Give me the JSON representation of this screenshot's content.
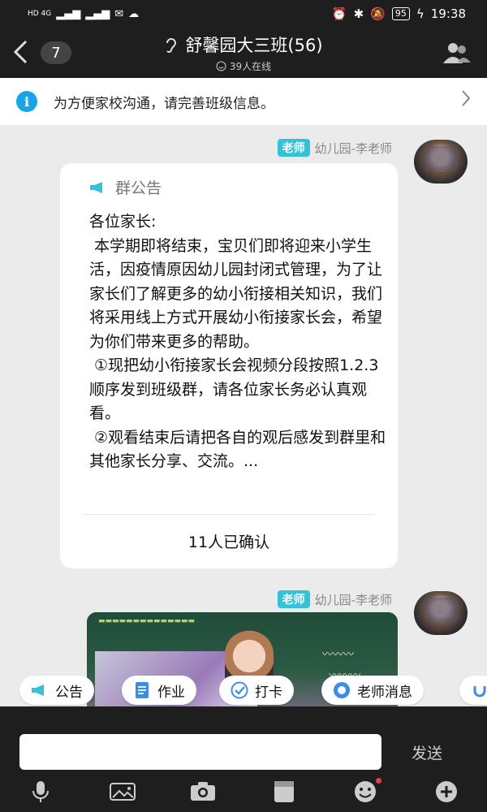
{
  "status_bar": {
    "network": "HD 4G",
    "time": "19:38",
    "battery": "95"
  },
  "header": {
    "unread_count": "7",
    "title": "舒馨园大三班(56)",
    "online": "39人在线"
  },
  "notice_banner": {
    "text": "为方便家校沟通，请完善班级信息。"
  },
  "messages": [
    {
      "role_tag": "老师",
      "sender": "幼儿园-李老师",
      "card_title": "群公告",
      "body": "各位家长:\n 本学期即将结束，宝贝们即将迎来小学生活，因疫情原因幼儿园封闭式管理，为了让家长们了解更多的幼小衔接相关知识，我们将采用线上方式开展幼小衔接家长会，希望为你们带来更多的帮助。\n ①现把幼小衔接家长会视频分段按照1.2.3顺序发到班级群，请各位家长务必认真观看。\n ②观看结束后请把各自的观后感发到群里和其他家长分享、交流。...",
      "confirm_text": "11人已确认"
    },
    {
      "role_tag": "老师",
      "sender": "幼儿园-李老师"
    }
  ],
  "quick_actions": [
    {
      "label": "公告",
      "icon": "megaphone-icon"
    },
    {
      "label": "作业",
      "icon": "document-icon"
    },
    {
      "label": "打卡",
      "icon": "check-circle-icon"
    },
    {
      "label": "老师消息",
      "icon": "chat-bubble-icon"
    }
  ],
  "input": {
    "placeholder": "",
    "send_label": "发送"
  },
  "toolbar": [
    "microphone-icon",
    "photo-icon",
    "camera-icon",
    "clipboard-icon",
    "emoji-icon",
    "plus-icon"
  ],
  "colors": {
    "accent": "#35c2d8",
    "info_blue": "#1aa4e8",
    "bar_dark": "#1e1e1e",
    "chat_bg": "#ebebeb",
    "badge_red": "#f03c3c"
  }
}
